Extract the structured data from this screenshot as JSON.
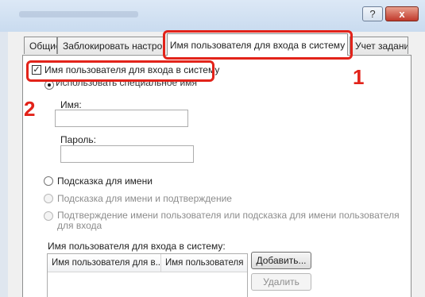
{
  "window": {
    "help_label": "?",
    "close_label": "x"
  },
  "tabs": [
    {
      "label": "Общие"
    },
    {
      "label": "Заблокировать настройк"
    },
    {
      "label": "Имя пользователя для входа в систему"
    },
    {
      "label": "Учет заданий"
    }
  ],
  "callouts": {
    "step1": "1",
    "step2": "2"
  },
  "login": {
    "enable_checkbox_label": "Имя пользователя для входа в систему",
    "enable_checked": true,
    "check_glyph": "✓",
    "clipped_option_label": "Использовать специальное имя",
    "name_label": "Имя:",
    "name_value": "",
    "password_label": "Пароль:",
    "password_value": "",
    "radio_hint": "Подсказка для имени",
    "radio_hint_confirm": "Подсказка для имени и подтверждение",
    "radio_confirm_or_hint": "Подтверждение имени пользователя или подсказка для имени пользователя для входа"
  },
  "list": {
    "title": "Имя пользователя для входа в систему:",
    "columns": [
      "Имя пользователя для в...",
      "Имя пользователя"
    ],
    "add_button": "Добавить...",
    "delete_button": "Удалить"
  }
}
